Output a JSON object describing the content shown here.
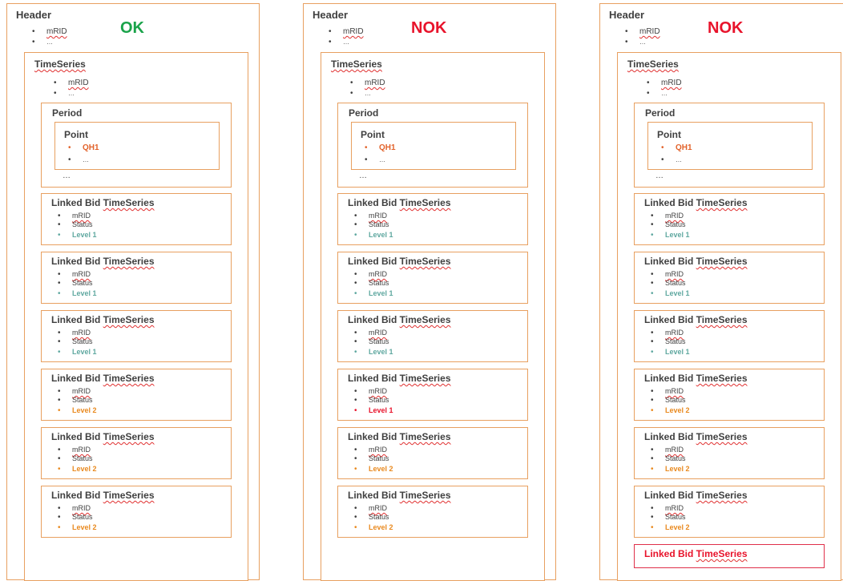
{
  "labels": {
    "header": "Header",
    "mrid": "mRID",
    "dots": "…",
    "timeseries": "TimeSeries",
    "period": "Period",
    "point": "Point",
    "qh1": "QH1",
    "period_dots": "…",
    "linked_prefix": "Linked Bid ",
    "linked_suffix": "TimeSeries",
    "status": "Status"
  },
  "colors": {
    "ok": "#1aa34a",
    "nok": "#e8132b",
    "level1": "#5fa8a0",
    "level2": "#e98a20",
    "error": "#e8132b",
    "qh": "#e2622a",
    "border": "#e8a060"
  },
  "columns": [
    {
      "verdict": "OK",
      "levels": [
        "Level 1",
        "Level 1",
        "Level 1",
        "Level 2",
        "Level 2",
        "Level 2"
      ],
      "level_colors": [
        "level1",
        "level1",
        "level1",
        "level2",
        "level2",
        "level2"
      ],
      "extra_linked": false
    },
    {
      "verdict": "NOK",
      "levels": [
        "Level 1",
        "Level 1",
        "Level 1",
        "Level 1",
        "Level 2",
        "Level 2"
      ],
      "level_colors": [
        "level1",
        "level1",
        "level1",
        "error",
        "level2",
        "level2"
      ],
      "extra_linked": false
    },
    {
      "verdict": "NOK",
      "levels": [
        "Level 1",
        "Level 1",
        "Level 1",
        "Level 2",
        "Level 2",
        "Level 2"
      ],
      "level_colors": [
        "level1",
        "level1",
        "level1",
        "level2",
        "level2",
        "level2"
      ],
      "extra_linked": true
    }
  ]
}
